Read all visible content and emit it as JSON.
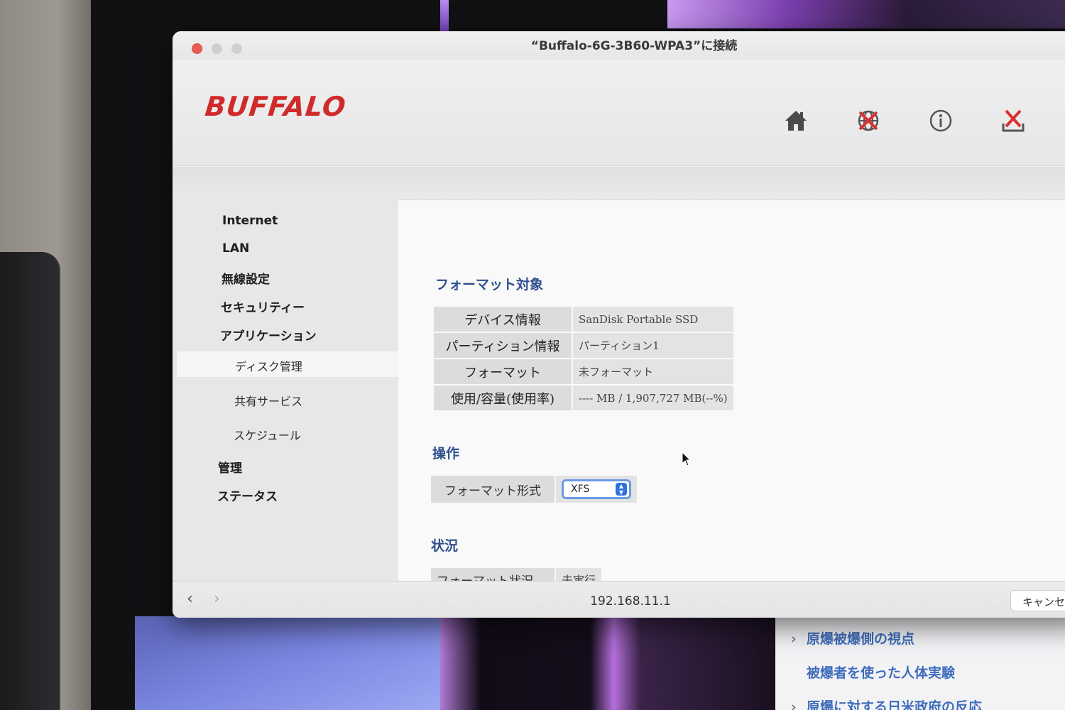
{
  "window": {
    "title": "“Buffalo-6G-3B60-WPA3”に接続",
    "address": "192.168.11.1",
    "cancel_label": "キャンセ"
  },
  "header": {
    "logo": "BUFFALO",
    "icons": [
      "home-icon",
      "network-diagnostic-icon",
      "info-icon",
      "logout-icon"
    ]
  },
  "sidebar": {
    "items": [
      {
        "label": "Internet"
      },
      {
        "label": "LAN"
      },
      {
        "label": "無線設定"
      },
      {
        "label": "セキュリティー"
      },
      {
        "label": "アプリケーション"
      },
      {
        "label": "ディスク管理"
      },
      {
        "label": "共有サービス"
      },
      {
        "label": "スケジュール"
      },
      {
        "label": "管理"
      },
      {
        "label": "ステータス"
      }
    ],
    "active": "ディスク管理"
  },
  "main": {
    "target_title": "フォーマット対象",
    "target_rows": [
      {
        "key": "デバイス情報",
        "value": "SanDisk Portable SSD"
      },
      {
        "key": "パーティション情報",
        "value": "パーティション1"
      },
      {
        "key": "フォーマット",
        "value": "未フォーマット"
      },
      {
        "key": "使用/容量(使用率)",
        "value": "---- MB / 1,907,727 MB(--%)"
      }
    ],
    "operation_title": "操作",
    "format_type_label": "フォーマット形式",
    "format_type_value": "XFS",
    "status_title": "状況",
    "status_label": "フォーマット状況",
    "status_value": "未実行"
  },
  "background_page": {
    "links": [
      "原爆被爆側の視点",
      "被爆者を使った人体実験",
      "原爆に対する日米政府の反応"
    ]
  },
  "colors": {
    "brand_red": "#d02a2a",
    "section_blue": "#2f4f8f",
    "select_focus": "#6a9be6"
  }
}
